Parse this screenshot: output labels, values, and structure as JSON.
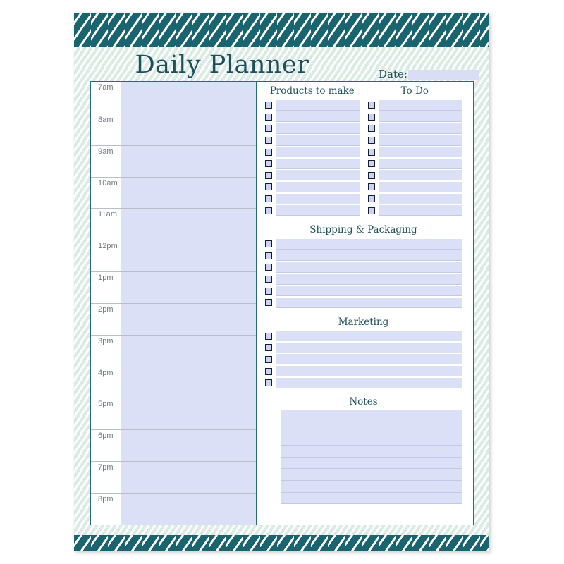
{
  "document": {
    "title": "Daily Planner",
    "date_label": "Date:",
    "date_value": ""
  },
  "theme": {
    "band_teal": "#19646f",
    "ink_teal": "#1d4f5c",
    "fill_lavender": "#dce0f6",
    "checkbox_fill": "#ccd3f2",
    "checkbox_border": "#14202c",
    "rule_gray": "#b9bfc6",
    "page_bg": "#f3f8f5"
  },
  "schedule": {
    "name": "hourly-schedule",
    "slots": [
      {
        "time": "7am"
      },
      {
        "time": "8am"
      },
      {
        "time": "9am"
      },
      {
        "time": "10am"
      },
      {
        "time": "11am"
      },
      {
        "time": "12pm"
      },
      {
        "time": "1pm"
      },
      {
        "time": "2pm"
      },
      {
        "time": "3pm"
      },
      {
        "time": "4pm"
      },
      {
        "time": "5pm"
      },
      {
        "time": "6pm"
      },
      {
        "time": "7pm"
      },
      {
        "time": "8pm"
      }
    ]
  },
  "sections": {
    "products": {
      "title": "Products to make",
      "row_count": 10,
      "has_checkboxes": true,
      "items": [
        "",
        "",
        "",
        "",
        "",
        "",
        "",
        "",
        "",
        ""
      ]
    },
    "todo": {
      "title": "To Do",
      "row_count": 10,
      "has_checkboxes": true,
      "items": [
        "",
        "",
        "",
        "",
        "",
        "",
        "",
        "",
        "",
        ""
      ]
    },
    "shipping": {
      "title": "Shipping & Packaging",
      "row_count": 6,
      "has_checkboxes": true,
      "items": [
        "",
        "",
        "",
        "",
        "",
        ""
      ]
    },
    "marketing": {
      "title": "Marketing",
      "row_count": 5,
      "has_checkboxes": true,
      "items": [
        "",
        "",
        "",
        "",
        ""
      ]
    },
    "notes": {
      "title": "Notes",
      "row_count": 8,
      "has_checkboxes": false,
      "items": [
        "",
        "",
        "",
        "",
        "",
        "",
        "",
        ""
      ]
    }
  }
}
